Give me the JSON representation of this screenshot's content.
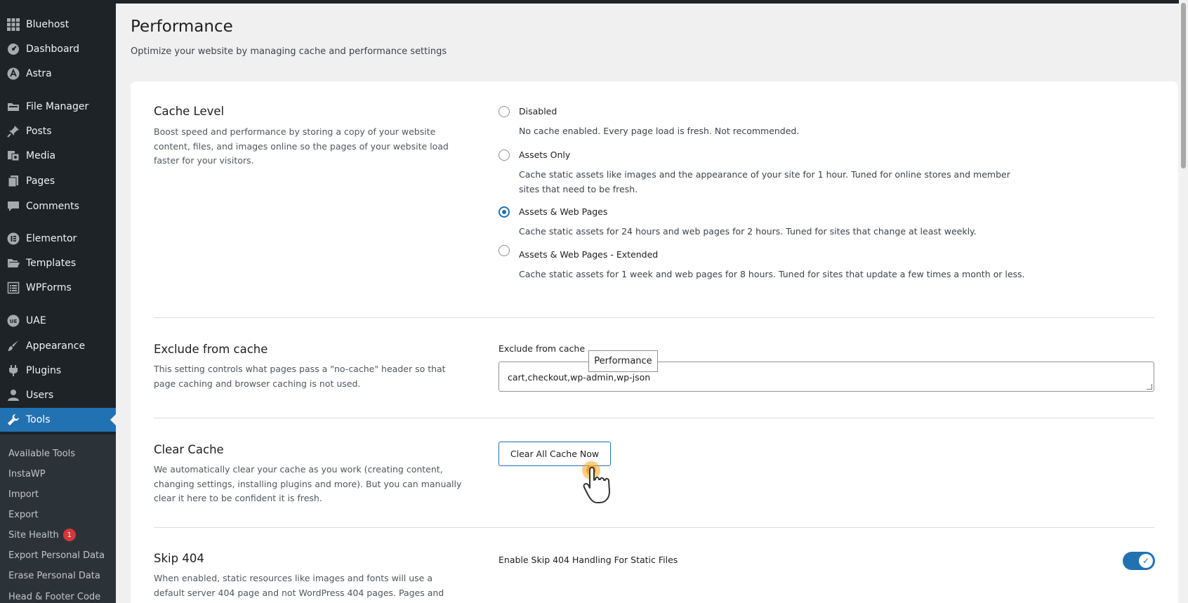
{
  "sidebar": {
    "items": [
      {
        "label": "Bluehost",
        "icon": "grid-icon"
      },
      {
        "label": "Dashboard",
        "icon": "dashboard-icon"
      },
      {
        "label": "Astra",
        "icon": "astra-icon"
      },
      {
        "label": "File Manager",
        "icon": "folder-icon"
      },
      {
        "label": "Posts",
        "icon": "pin-icon"
      },
      {
        "label": "Media",
        "icon": "media-icon"
      },
      {
        "label": "Pages",
        "icon": "pages-icon"
      },
      {
        "label": "Comments",
        "icon": "comment-icon"
      },
      {
        "label": "Elementor",
        "icon": "elementor-icon"
      },
      {
        "label": "Templates",
        "icon": "folder-open-icon"
      },
      {
        "label": "WPForms",
        "icon": "form-icon"
      },
      {
        "label": "UAE",
        "icon": "uae-icon"
      },
      {
        "label": "Appearance",
        "icon": "brush-icon"
      },
      {
        "label": "Plugins",
        "icon": "plug-icon"
      },
      {
        "label": "Users",
        "icon": "user-icon"
      },
      {
        "label": "Tools",
        "icon": "wrench-icon"
      }
    ],
    "submenu": [
      {
        "label": "Available Tools"
      },
      {
        "label": "InstaWP"
      },
      {
        "label": "Import"
      },
      {
        "label": "Export"
      },
      {
        "label": "Site Health",
        "badge": "1"
      },
      {
        "label": "Export Personal Data"
      },
      {
        "label": "Erase Personal Data"
      },
      {
        "label": "Head & Footer Code"
      }
    ]
  },
  "page": {
    "title": "Performance",
    "subtitle": "Optimize your website by managing cache and performance settings"
  },
  "cache_level": {
    "title": "Cache Level",
    "description": "Boost speed and performance by storing a copy of your website content, files, and images online so the pages of your website load faster for your visitors.",
    "options": [
      {
        "label": "Disabled",
        "description": "No cache enabled. Every page load is fresh. Not recommended.",
        "checked": false
      },
      {
        "label": "Assets Only",
        "description": "Cache static assets like images and the appearance of your site for 1 hour. Tuned for online stores and member sites that need to be fresh.",
        "checked": false
      },
      {
        "label": "Assets & Web Pages",
        "description": "Cache static assets for 24 hours and web pages for 2 hours. Tuned for sites that change at least weekly.",
        "checked": true
      },
      {
        "label": "Assets & Web Pages - Extended",
        "description": "Cache static assets for 1 week and web pages for 8 hours. Tuned for sites that update a few times a month or less.",
        "checked": false
      }
    ]
  },
  "exclude": {
    "title": "Exclude from cache",
    "description": "This setting controls what pages pass a \"no-cache\" header so that page caching and browser caching is not used.",
    "field_label": "Exclude from cache",
    "value": "cart,checkout,wp-admin,wp-json",
    "tooltip": "Performance"
  },
  "clear_cache": {
    "title": "Clear Cache",
    "description": "We automatically clear your cache as you work (creating content, changing settings, installing plugins and more). But you can manually clear it here to be confident it is fresh.",
    "button_label": "Clear All Cache Now"
  },
  "skip404": {
    "title": "Skip 404",
    "description": "When enabled, static resources like images and fonts will use a default server 404 page and not WordPress 404 pages. Pages and posts will",
    "toggle_label": "Enable Skip 404 Handling For Static Files",
    "enabled": true
  },
  "colors": {
    "sidebar": "#1d2327",
    "accent": "#2271b1",
    "badge": "#d63638"
  }
}
